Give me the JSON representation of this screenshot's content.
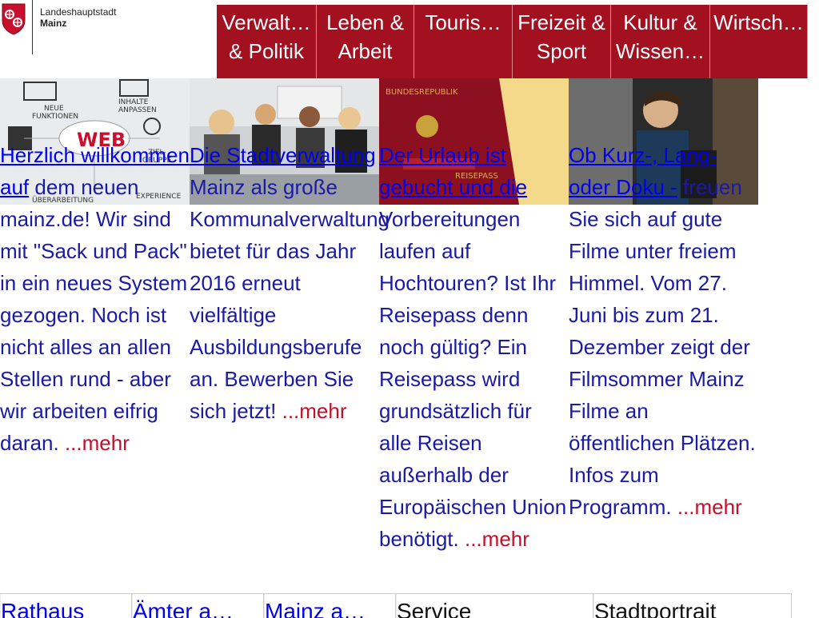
{
  "header": {
    "logo_line1": "Landeshauptstadt",
    "logo_line2": "Mainz"
  },
  "nav": [
    {
      "line1": "Verwalt…",
      "line2": "& Politik"
    },
    {
      "line1": "Leben &",
      "line2": "Arbeit"
    },
    {
      "line1": "Touris…",
      "line2": ""
    },
    {
      "line1": "Freizeit &",
      "line2": "Sport"
    },
    {
      "line1": "Kultur &",
      "line2": "Wissen…"
    },
    {
      "line1": "Wirtsch…",
      "line2": ""
    }
  ],
  "teasers": [
    {
      "image": "web-launch-graphic",
      "link": "Herzlich willkommen auf",
      "body": "dem neuen mainz.de! Wir sind mit \"Sack und Pack\" in ein neues System gezogen. Noch ist nicht alles an allen Stellen rund - aber wir arbeiten eifrig daran. ",
      "more": "...mehr"
    },
    {
      "image": "trainees-group-photo",
      "link": "Die Stadtverwaltung",
      "body": "Mainz als große Kommunalverwaltung bietet für das Jahr 2016 erneut vielfältige Ausbildungsberufe an. Bewerben Sie sich jetzt! ",
      "more": "...mehr"
    },
    {
      "image": "passport-photo",
      "link": "Der Urlaub ist gebucht und die",
      "body": "Vorbereitungen laufen auf Hochtouren? Ist Ihr Reisepass denn noch gültig? Ein Reisepass wird grundsätzlich für alle Reisen außerhalb der Europäischen Union benötigt. ",
      "more": "...mehr"
    },
    {
      "image": "film-summer-photo",
      "link": "Ob Kurz-, Lang- oder Doku -",
      "body": "freuen Sie sich auf gute Filme unter freiem Himmel. Vom 27. Juni bis zum 21. Dezember zeigt der Filmsommer Mainz Filme an öffentlichen Plätzen. Infos zum Programm. ",
      "more": "...mehr"
    }
  ],
  "bottom": [
    {
      "label": "Rathaus",
      "type": "link"
    },
    {
      "label": "Ämter a…",
      "type": "link"
    },
    {
      "label": "Mainz a…",
      "type": "link"
    },
    {
      "label": "Service",
      "type": "plain"
    },
    {
      "label": "Stadtportrait",
      "type": "plain"
    }
  ],
  "colors": {
    "brand_red": "#a3101f",
    "link_blue": "#0000ee",
    "more_red": "#c0102a"
  }
}
